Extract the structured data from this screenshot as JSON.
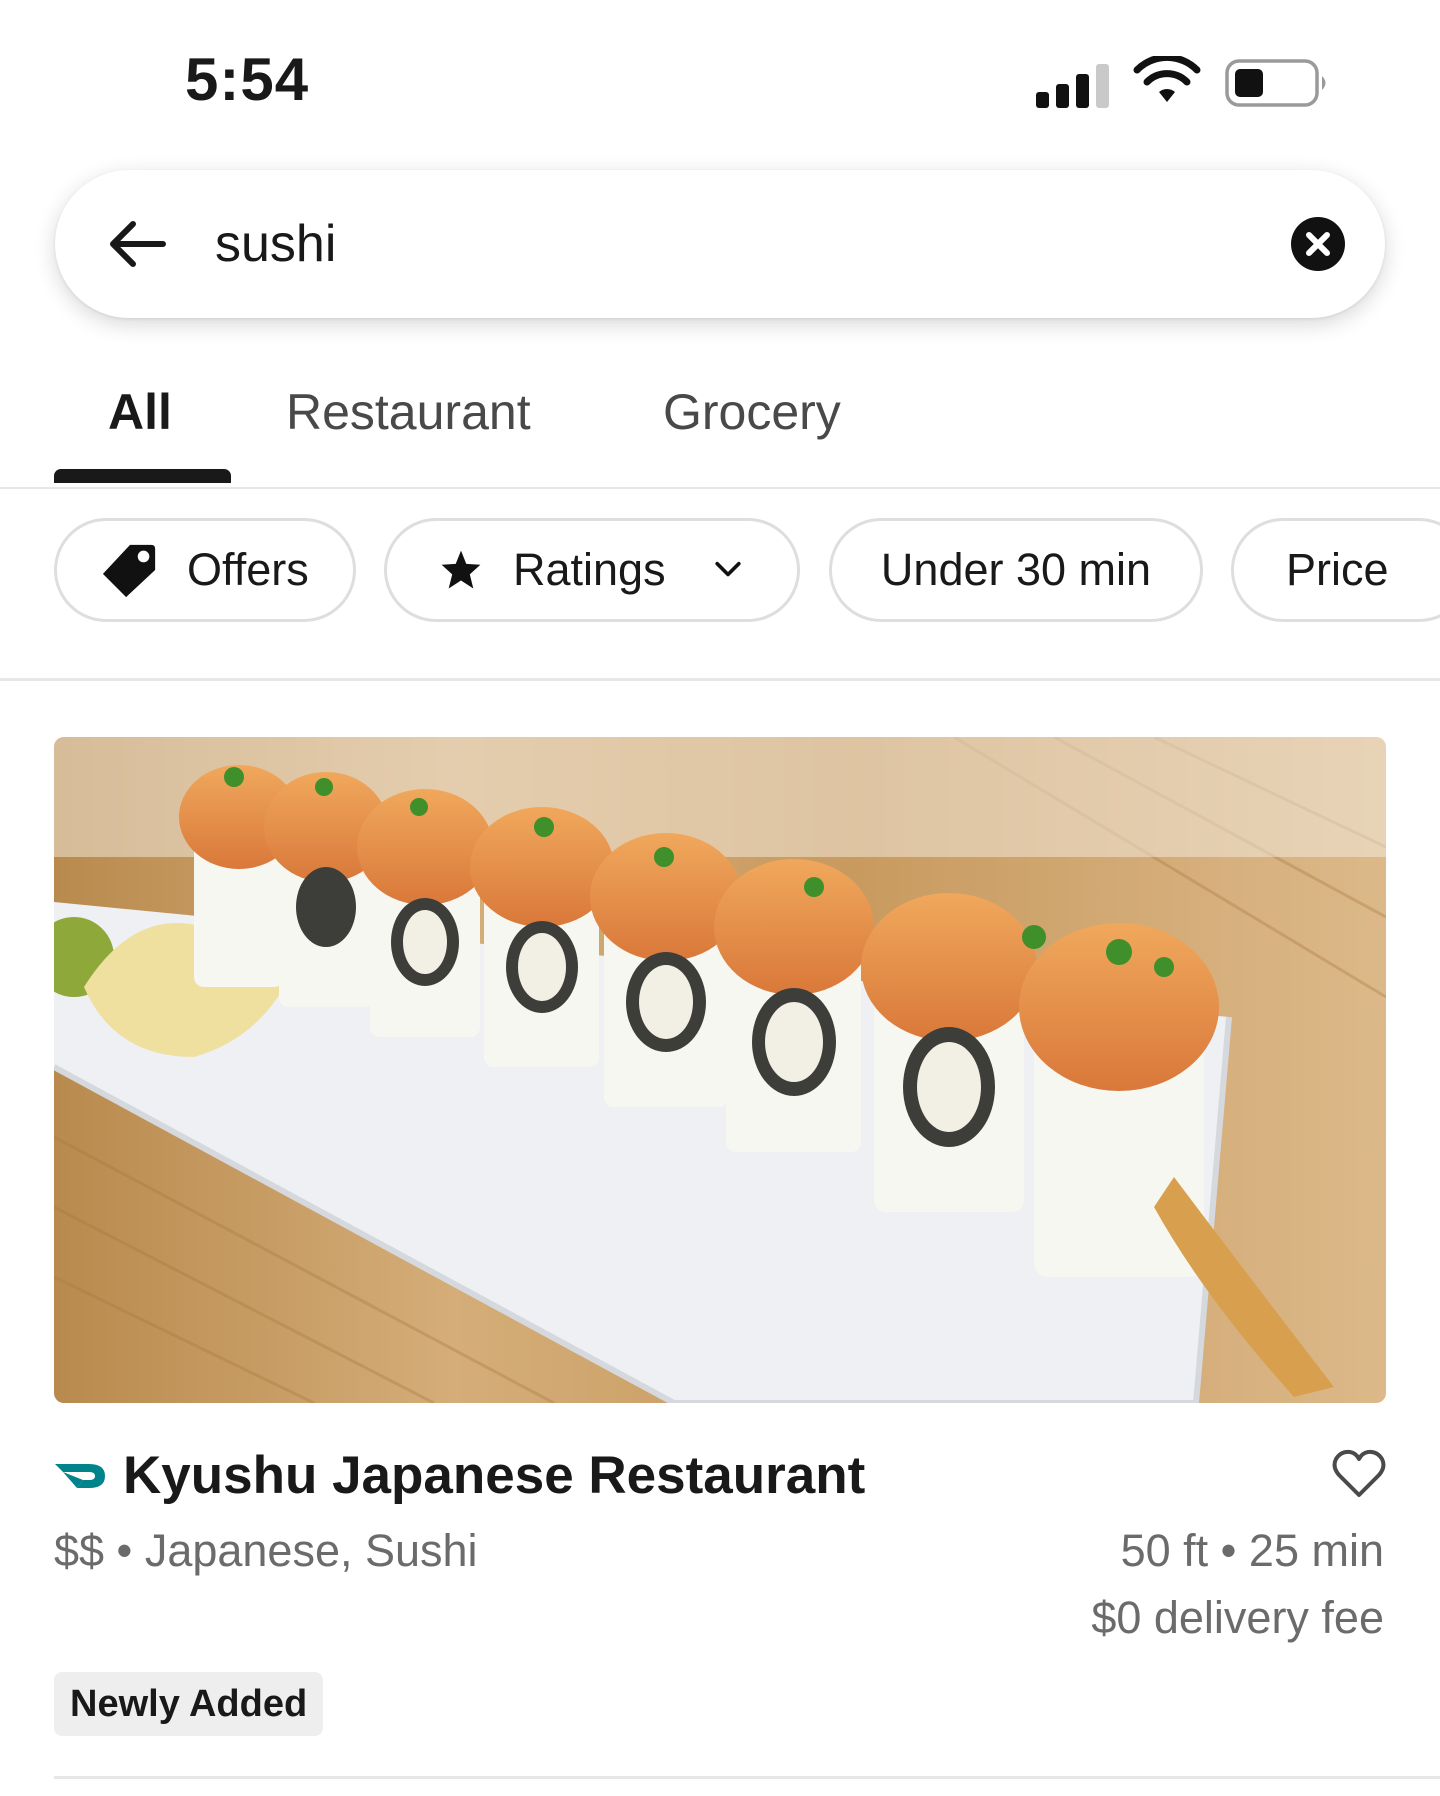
{
  "status_bar": {
    "time": "5:54",
    "signal_icon": "cellular-signal-icon",
    "wifi_icon": "wifi-icon",
    "battery_icon": "battery-icon",
    "battery_level": 0.35
  },
  "search": {
    "back_icon": "arrow-left-icon",
    "query": "sushi",
    "clear_icon": "clear-x-icon"
  },
  "tabs": [
    {
      "label": "All",
      "active": true
    },
    {
      "label": "Restaurant",
      "active": false
    },
    {
      "label": "Grocery",
      "active": false
    }
  ],
  "filters": {
    "offers": {
      "label": "Offers",
      "icon": "tag-icon"
    },
    "ratings": {
      "label": "Ratings",
      "icon": "star-icon",
      "dropdown_icon": "chevron-down-icon"
    },
    "under30": {
      "label": "Under 30 min"
    },
    "price": {
      "label": "Price"
    }
  },
  "result": {
    "name": "Kyushu Japanese Restaurant",
    "dashpass_icon": "dashpass-icon",
    "favorite_icon": "heart-outline-icon",
    "meta": "$$ • Japanese, Sushi",
    "distance_time": "50 ft • 25 min",
    "delivery_fee": "$0 delivery fee",
    "badge": "Newly Added",
    "image": "sushi-roll-photo"
  },
  "colors": {
    "text_primary": "#191919",
    "text_secondary": "#6b6b6b",
    "dashpass_teal": "#00838a",
    "divider": "#e7e7e7"
  }
}
